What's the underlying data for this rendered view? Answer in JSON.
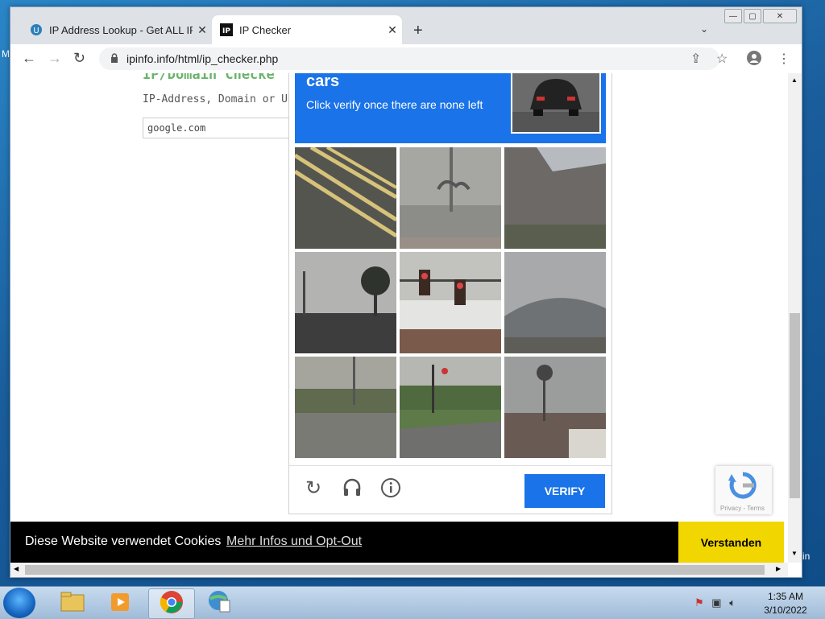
{
  "browser": {
    "tabs": [
      {
        "title": "IP Address Lookup - Get ALL IP L",
        "active": false
      },
      {
        "title": "IP Checker",
        "active": true
      }
    ],
    "new_tab": "+",
    "url": "ipinfo.info/html/ip_checker.php"
  },
  "page": {
    "heading": "IP/Domain Checke",
    "label": "IP-Address, Domain or UR",
    "input_value": "google.com"
  },
  "captcha": {
    "instruction_title": "cars",
    "instruction_text": "Click verify once there are none left",
    "verify_label": "VERIFY",
    "tiles": [
      {
        "name": "road-lines",
        "bg": "#5a5a55"
      },
      {
        "name": "palm-building",
        "bg": "#9a9a96"
      },
      {
        "name": "building-roof",
        "bg": "#6e6a66"
      },
      {
        "name": "palm-tree",
        "bg": "#a8a8a6"
      },
      {
        "name": "traffic-lights",
        "bg": "#b9b9b4"
      },
      {
        "name": "roof",
        "bg": "#7d7a78"
      },
      {
        "name": "street-trees",
        "bg": "#8e8a80"
      },
      {
        "name": "intersection",
        "bg": "#7e8476"
      },
      {
        "name": "palm-sky",
        "bg": "#8e8f8d"
      }
    ]
  },
  "recaptcha": {
    "links": "Privacy - Terms"
  },
  "cookie": {
    "message": "Diese Website verwendet Cookies",
    "link": "Mehr Infos und Opt-Out",
    "accept": "Verstanden"
  },
  "taskbar": {
    "time": "1:35 AM",
    "date": "3/10/2022"
  },
  "desktop": {
    "left_label": "M",
    "right_label": "in"
  }
}
